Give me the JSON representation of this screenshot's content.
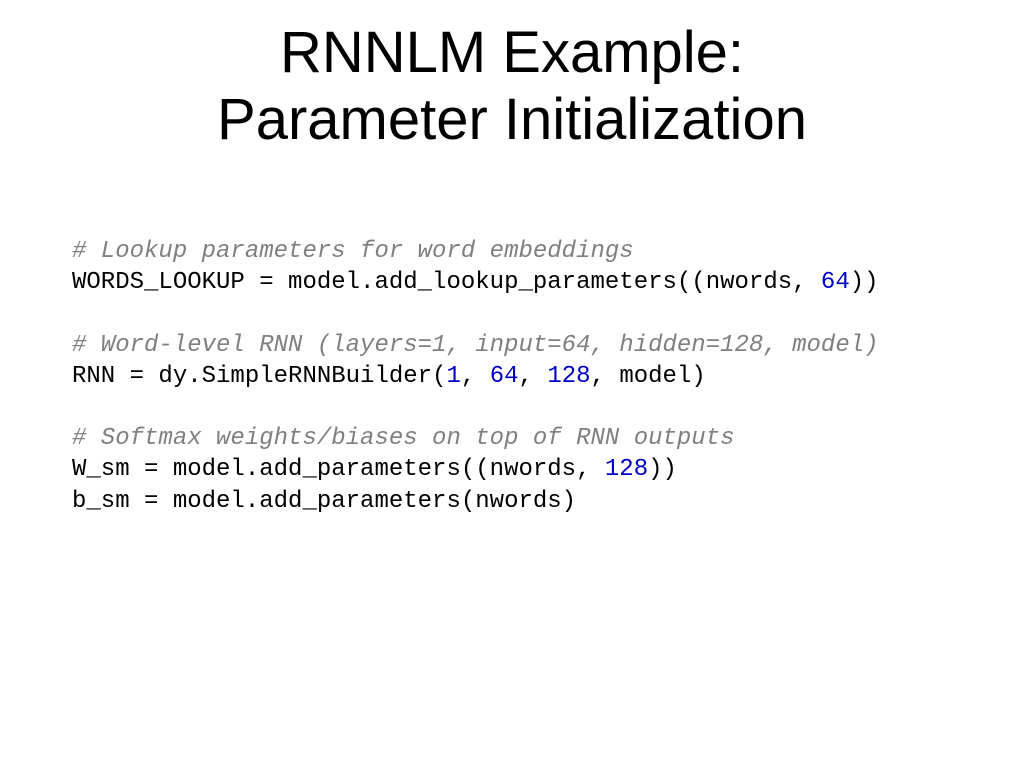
{
  "title_line1": "RNNLM Example:",
  "title_line2": "Parameter Initialization",
  "code": {
    "c1": "# Lookup parameters for word embeddings",
    "l1a": "WORDS_LOOKUP = model.add_lookup_parameters((nwords, ",
    "l1n": "64",
    "l1b": "))",
    "c2": "# Word-level RNN (layers=1, input=64, hidden=128, model)",
    "l2a": "RNN = dy.SimpleRNNBuilder(",
    "l2n1": "1",
    "l2s1": ", ",
    "l2n2": "64",
    "l2s2": ", ",
    "l2n3": "128",
    "l2b": ", model)",
    "c3": "# Softmax weights/biases on top of RNN outputs",
    "l3a": "W_sm = model.add_parameters((nwords, ",
    "l3n": "128",
    "l3b": "))",
    "l4": "b_sm = model.add_parameters(nwords)"
  }
}
